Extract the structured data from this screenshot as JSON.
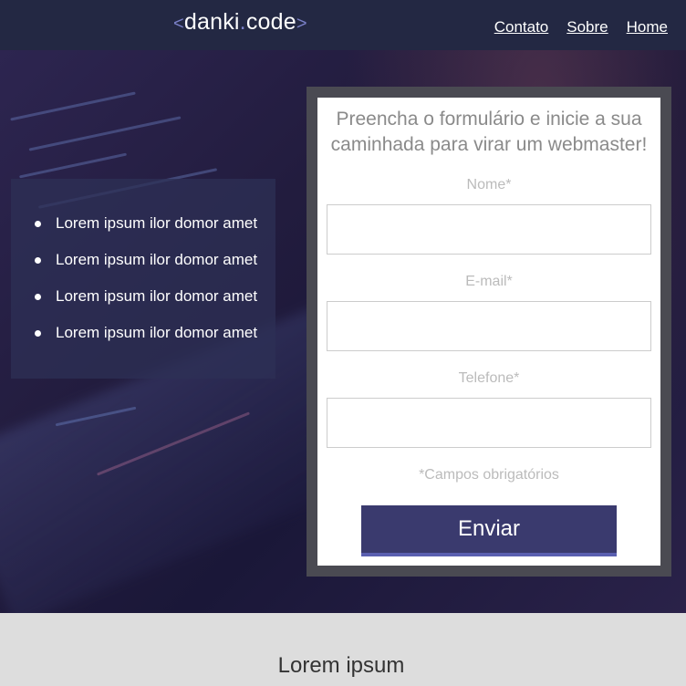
{
  "header": {
    "logo": {
      "open": "<",
      "part1": "danki",
      "dot": ".",
      "part2": "code",
      "close": ">"
    },
    "nav": [
      {
        "label": "Contato"
      },
      {
        "label": "Sobre"
      },
      {
        "label": "Home"
      }
    ]
  },
  "features": {
    "items": [
      "Lorem ipsum ilor domor amet",
      "Lorem ipsum ilor domor amet",
      "Lorem ipsum ilor domor amet",
      "Lorem ipsum ilor domor amet"
    ]
  },
  "form": {
    "title": "Preencha o formulário e inicie a sua caminhada para virar um webmaster!",
    "fields": [
      {
        "label": "Nome*",
        "value": ""
      },
      {
        "label": "E-mail*",
        "value": ""
      },
      {
        "label": "Telefone*",
        "value": ""
      }
    ],
    "required_note": "*Campos obrigatórios",
    "submit_label": "Enviar"
  },
  "section": {
    "title": "Lorem ipsum"
  },
  "colors": {
    "header_bg": "#232843",
    "submit_bg": "#3a3a6e",
    "form_frame": "#4a4a52"
  }
}
